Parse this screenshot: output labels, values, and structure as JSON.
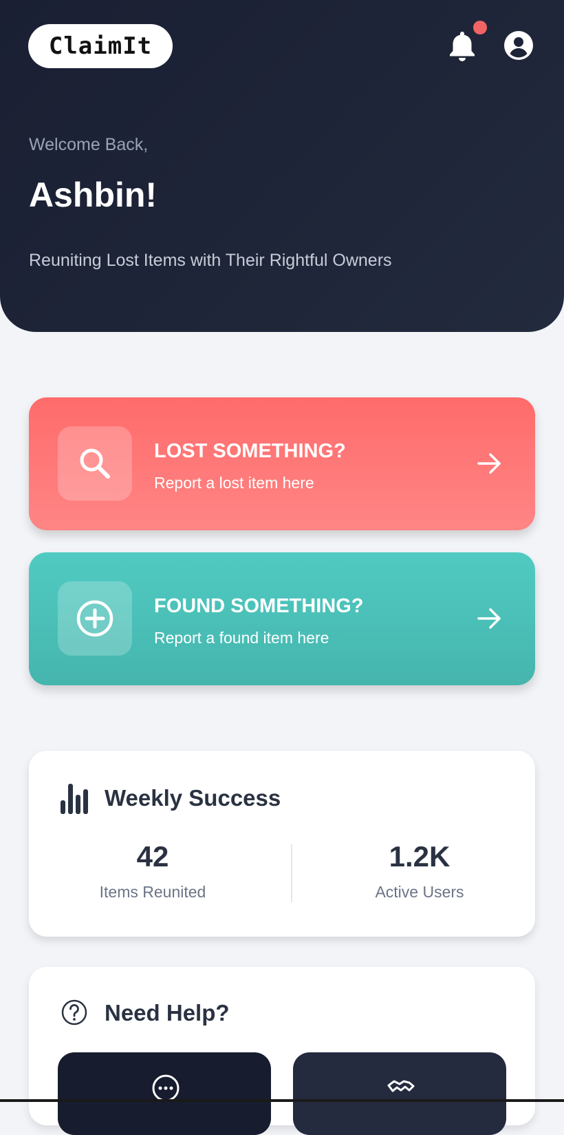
{
  "app": {
    "logo_text": "ClaimIt"
  },
  "header": {
    "welcome": "Welcome Back,",
    "username": "Ashbin!",
    "tagline": "Reuniting Lost Items with Their Rightful Owners",
    "icons": {
      "notifications": "bell-icon",
      "profile": "user-circle-icon"
    },
    "notification_dot_color": "#f26464"
  },
  "actions": {
    "lost": {
      "title": "LOST SOMETHING?",
      "subtitle": "Report a lost item here",
      "icon": "search-icon",
      "color": "#ff6b6b"
    },
    "found": {
      "title": "FOUND SOMETHING?",
      "subtitle": "Report a found item here",
      "icon": "plus-circle-icon",
      "color": "#4ec9c0"
    }
  },
  "stats": {
    "title": "Weekly Success",
    "icon": "bar-chart-icon",
    "items": [
      {
        "value": "42",
        "label": "Items Reunited"
      },
      {
        "value": "1.2K",
        "label": "Active Users"
      }
    ]
  },
  "help": {
    "title": "Need Help?",
    "icon": "question-circle-icon",
    "buttons": [
      {
        "icon": "chat-icon"
      },
      {
        "icon": "handshake-icon"
      }
    ]
  },
  "colors": {
    "header_bg": "#1c2235",
    "page_bg": "#f2f4f8",
    "text_dark": "#2a3242"
  }
}
